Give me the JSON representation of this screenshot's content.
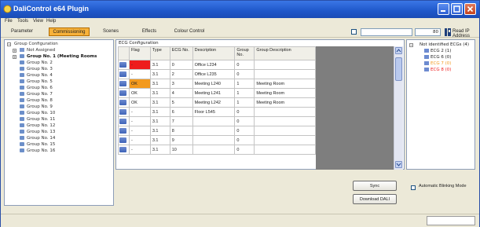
{
  "window": {
    "title": "DaliControl e64 Plugin"
  },
  "menu": [
    "File",
    "Tools",
    "View",
    "Help"
  ],
  "tabs": [
    {
      "label": "Parameter",
      "active": false
    },
    {
      "label": "Commissioning",
      "active": true
    },
    {
      "label": "Scenes",
      "active": false
    },
    {
      "label": "Effects",
      "active": false
    },
    {
      "label": "Colour Control",
      "active": false
    }
  ],
  "toolbar": {
    "field_value": "",
    "zoom_value": "80",
    "read_ip_label": "Read IP Address"
  },
  "tree": {
    "root": "Group Configuration",
    "items": [
      {
        "label": "Not Assigned",
        "bold": false
      },
      {
        "label": "Group No. 1 (Meeting Rooms",
        "bold": true
      },
      {
        "label": "Group No. 2",
        "bold": false
      },
      {
        "label": "Group No. 3",
        "bold": false
      },
      {
        "label": "Group No. 4",
        "bold": false
      },
      {
        "label": "Group No. 5",
        "bold": false
      },
      {
        "label": "Group No. 6",
        "bold": false
      },
      {
        "label": "Group No. 7",
        "bold": false
      },
      {
        "label": "Group No. 8",
        "bold": false
      },
      {
        "label": "Group No. 9",
        "bold": false
      },
      {
        "label": "Group No. 10",
        "bold": false
      },
      {
        "label": "Group No. 11",
        "bold": false
      },
      {
        "label": "Group No. 12",
        "bold": false
      },
      {
        "label": "Group No. 13",
        "bold": false
      },
      {
        "label": "Group No. 14",
        "bold": false
      },
      {
        "label": "Group No. 15",
        "bold": false
      },
      {
        "label": "Group No. 16",
        "bold": false
      }
    ]
  },
  "ecg": {
    "header": "ECG Configuration",
    "columns": [
      "",
      "Flag",
      "Type",
      "ECG No.",
      "Description",
      "Group No.",
      "Group Description"
    ],
    "rows": [
      {
        "flag": "-",
        "flag_color": "#ee1c1c",
        "type": "3.1",
        "no": "0",
        "desc": "Office L234",
        "group": "0",
        "gdesc": ""
      },
      {
        "flag": "-",
        "flag_color": "",
        "type": "3.1",
        "no": "2",
        "desc": "Office L235",
        "group": "0",
        "gdesc": ""
      },
      {
        "flag": "OK",
        "flag_color": "#f39a1e",
        "type": "3.1",
        "no": "3",
        "desc": "Meeting L240",
        "group": "1",
        "gdesc": "Meeting Room"
      },
      {
        "flag": "OK",
        "flag_color": "",
        "type": "3.1",
        "no": "4",
        "desc": "Meeting L241",
        "group": "1",
        "gdesc": "Meeting Room"
      },
      {
        "flag": "OK",
        "flag_color": "",
        "type": "3.1",
        "no": "5",
        "desc": "Meeting L242",
        "group": "1",
        "gdesc": "Meeting Room"
      },
      {
        "flag": "-",
        "flag_color": "",
        "type": "3.1",
        "no": "6",
        "desc": "Floor L545",
        "group": "0",
        "gdesc": ""
      },
      {
        "flag": "-",
        "flag_color": "",
        "type": "3.1",
        "no": "7",
        "desc": "",
        "group": "0",
        "gdesc": ""
      },
      {
        "flag": "-",
        "flag_color": "",
        "type": "3.1",
        "no": "8",
        "desc": "",
        "group": "0",
        "gdesc": ""
      },
      {
        "flag": "-",
        "flag_color": "",
        "type": "3.1",
        "no": "9",
        "desc": "",
        "group": "0",
        "gdesc": ""
      },
      {
        "flag": "-",
        "flag_color": "",
        "type": "3.1",
        "no": "10",
        "desc": "",
        "group": "0",
        "gdesc": ""
      }
    ]
  },
  "right": {
    "root": "Not identified ECGs (4)",
    "items": [
      {
        "label": "ECG 2 (1)",
        "color": "#222222"
      },
      {
        "label": "ECG 6 (0)",
        "color": "#222222"
      },
      {
        "label": "ECG 7 (0)",
        "color": "#f39a1e"
      },
      {
        "label": "ECG 8 (0)",
        "color": "#ee1c1c"
      }
    ]
  },
  "buttons": {
    "sync": "Sync",
    "download": "Download DALI"
  },
  "auto_blink": {
    "label": "Automatic Blinking Mode",
    "checked": false
  }
}
